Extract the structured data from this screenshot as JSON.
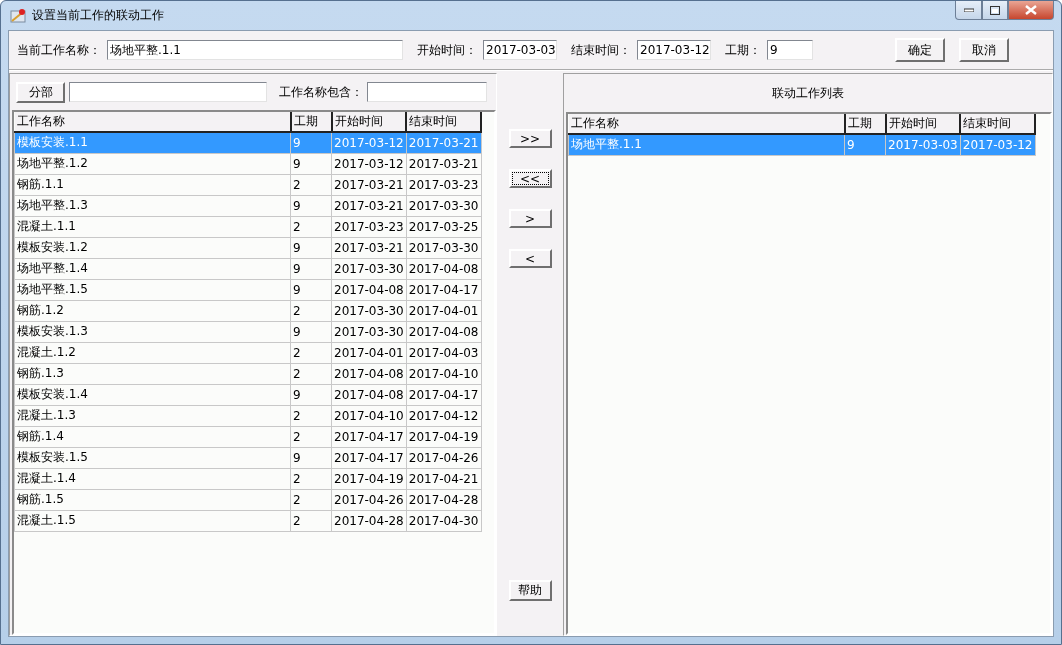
{
  "window": {
    "title": "设置当前工作的联动工作"
  },
  "header": {
    "fields": [
      {
        "label": "当前工作名称：",
        "value": "场地平整.1.1",
        "kind": "wide"
      },
      {
        "label": "开始时间：",
        "value": "2017-03-03",
        "kind": "date"
      },
      {
        "label": "结束时间：",
        "value": "2017-03-12",
        "kind": "date"
      },
      {
        "label": "工期：",
        "value": "9",
        "kind": "short"
      }
    ],
    "buttons": [
      "确定",
      "取消"
    ]
  },
  "filter": {
    "button": "分部",
    "label": "工作名称包含："
  },
  "left_table": {
    "columns": [
      "工作名称",
      "工期",
      "开始时间",
      "结束时间"
    ],
    "rows": [
      {
        "cells": [
          "模板安装.1.1",
          "9",
          "2017-03-12",
          "2017-03-21"
        ],
        "selected": true
      },
      {
        "cells": [
          "场地平整.1.2",
          "9",
          "2017-03-12",
          "2017-03-21"
        ],
        "selected": false
      },
      {
        "cells": [
          "钢筋.1.1",
          "2",
          "2017-03-21",
          "2017-03-23"
        ],
        "selected": false
      },
      {
        "cells": [
          "场地平整.1.3",
          "9",
          "2017-03-21",
          "2017-03-30"
        ],
        "selected": false
      },
      {
        "cells": [
          "混凝土.1.1",
          "2",
          "2017-03-23",
          "2017-03-25"
        ],
        "selected": false
      },
      {
        "cells": [
          "模板安装.1.2",
          "9",
          "2017-03-21",
          "2017-03-30"
        ],
        "selected": false
      },
      {
        "cells": [
          "场地平整.1.4",
          "9",
          "2017-03-30",
          "2017-04-08"
        ],
        "selected": false
      },
      {
        "cells": [
          "场地平整.1.5",
          "9",
          "2017-04-08",
          "2017-04-17"
        ],
        "selected": false
      },
      {
        "cells": [
          "钢筋.1.2",
          "2",
          "2017-03-30",
          "2017-04-01"
        ],
        "selected": false
      },
      {
        "cells": [
          "模板安装.1.3",
          "9",
          "2017-03-30",
          "2017-04-08"
        ],
        "selected": false
      },
      {
        "cells": [
          "混凝土.1.2",
          "2",
          "2017-04-01",
          "2017-04-03"
        ],
        "selected": false
      },
      {
        "cells": [
          "钢筋.1.3",
          "2",
          "2017-04-08",
          "2017-04-10"
        ],
        "selected": false
      },
      {
        "cells": [
          "模板安装.1.4",
          "9",
          "2017-04-08",
          "2017-04-17"
        ],
        "selected": false
      },
      {
        "cells": [
          "混凝土.1.3",
          "2",
          "2017-04-10",
          "2017-04-12"
        ],
        "selected": false
      },
      {
        "cells": [
          "钢筋.1.4",
          "2",
          "2017-04-17",
          "2017-04-19"
        ],
        "selected": false
      },
      {
        "cells": [
          "模板安装.1.5",
          "9",
          "2017-04-17",
          "2017-04-26"
        ],
        "selected": false
      },
      {
        "cells": [
          "混凝土.1.4",
          "2",
          "2017-04-19",
          "2017-04-21"
        ],
        "selected": false
      },
      {
        "cells": [
          "钢筋.1.5",
          "2",
          "2017-04-26",
          "2017-04-28"
        ],
        "selected": false
      },
      {
        "cells": [
          "混凝土.1.5",
          "2",
          "2017-04-28",
          "2017-04-30"
        ],
        "selected": false
      }
    ]
  },
  "transfer_buttons": [
    {
      "label": ">>",
      "focused": false
    },
    {
      "label": "<<",
      "focused": true
    },
    {
      "label": ">",
      "focused": false
    },
    {
      "label": "<",
      "focused": false
    }
  ],
  "help_button": "帮助",
  "right_panel": {
    "title": "联动工作列表",
    "table": {
      "columns": [
        "工作名称",
        "工期",
        "开始时间",
        "结束时间"
      ],
      "rows": [
        {
          "cells": [
            "场地平整.1.1",
            "9",
            "2017-03-03",
            "2017-03-12"
          ],
          "selected": true
        }
      ]
    }
  }
}
